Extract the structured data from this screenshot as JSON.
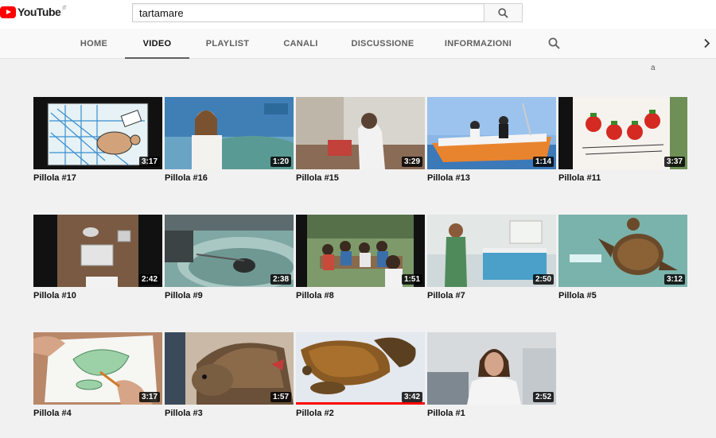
{
  "masthead": {
    "logo_text": "YouTube",
    "logo_region": "IT",
    "search_value": "tartamare",
    "search_icon": "search-icon"
  },
  "tabs": [
    {
      "label": "HOME",
      "active": false
    },
    {
      "label": "VIDEO",
      "active": true
    },
    {
      "label": "PLAYLIST",
      "active": false
    },
    {
      "label": "CANALI",
      "active": false
    },
    {
      "label": "DISCUSSIONE",
      "active": false
    },
    {
      "label": "INFORMAZIONI",
      "active": false
    }
  ],
  "sort_label": "a",
  "videos": [
    {
      "title": "Pillola #17",
      "duration": "3:17"
    },
    {
      "title": "Pillola #16",
      "duration": "1:20"
    },
    {
      "title": "Pillola #15",
      "duration": "3:29"
    },
    {
      "title": "Pillola #13",
      "duration": "1:14"
    },
    {
      "title": "Pillola #11",
      "duration": "3:37"
    },
    {
      "title": "Pillola #10",
      "duration": "2:42"
    },
    {
      "title": "Pillola #9",
      "duration": "2:38"
    },
    {
      "title": "Pillola #8",
      "duration": "1:51"
    },
    {
      "title": "Pillola #7",
      "duration": "2:50"
    },
    {
      "title": "Pillola #5",
      "duration": "3:12"
    },
    {
      "title": "Pillola #4",
      "duration": "3:17"
    },
    {
      "title": "Pillola #3",
      "duration": "1:57"
    },
    {
      "title": "Pillola #2",
      "duration": "3:42",
      "watched_fraction": 1.0
    },
    {
      "title": "Pillola #1",
      "duration": "2:52"
    }
  ],
  "colors": {
    "brand": "#ff0000",
    "tab_active": "#111111",
    "tab_inactive": "#606060"
  }
}
